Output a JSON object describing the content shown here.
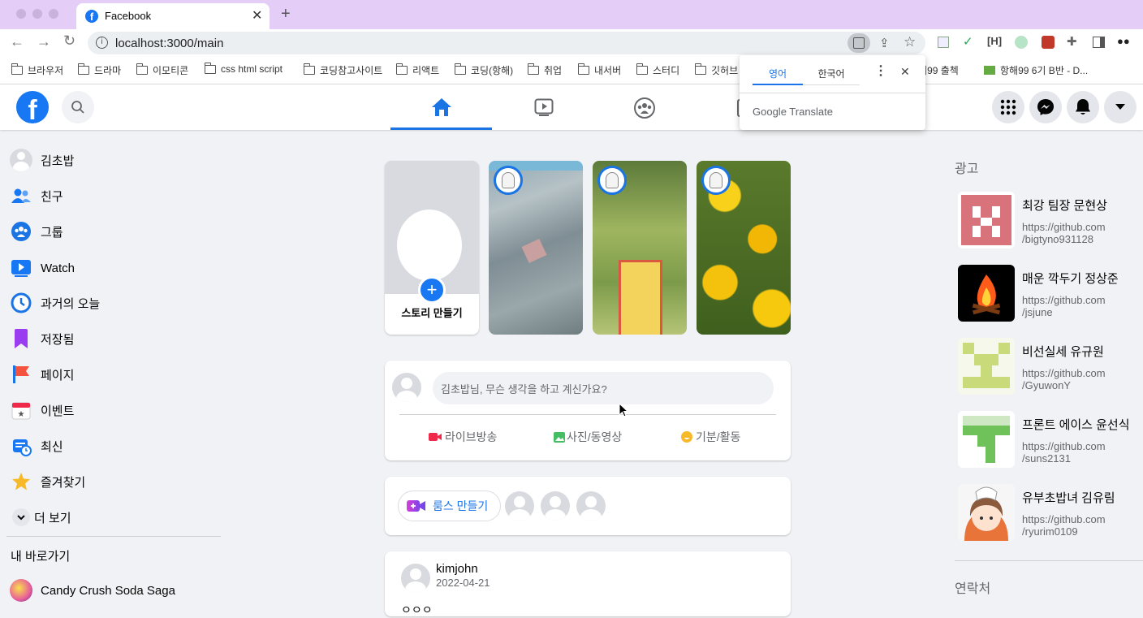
{
  "browser": {
    "tab_title": "Facebook",
    "url": "localhost:3000/main",
    "bookmarks": [
      "브라우저",
      "드라마",
      "이모티콘",
      "css html script",
      "코딩참고사이트",
      "리액트",
      "코딩(항해)",
      "취업",
      "내서버",
      "스터디",
      "깃허브"
    ],
    "bookmark_extra": [
      "항해99 출첵",
      "항해99 6기 B반 - D..."
    ]
  },
  "translate_popup": {
    "tab_source": "영어",
    "tab_target": "한국어",
    "brand": "Google Translate"
  },
  "sidebar": {
    "items": [
      {
        "label": "김초밥",
        "icon": "avatar-icon"
      },
      {
        "label": "친구",
        "icon": "friends-icon"
      },
      {
        "label": "그룹",
        "icon": "groups-icon"
      },
      {
        "label": "Watch",
        "icon": "watch-icon"
      },
      {
        "label": "과거의 오늘",
        "icon": "memories-icon"
      },
      {
        "label": "저장됨",
        "icon": "saved-icon"
      },
      {
        "label": "페이지",
        "icon": "pages-icon"
      },
      {
        "label": "이벤트",
        "icon": "events-icon"
      },
      {
        "label": "최신",
        "icon": "recent-icon"
      },
      {
        "label": "즐겨찾기",
        "icon": "favorites-icon"
      }
    ],
    "more": "더 보기",
    "shortcuts_title": "내 바로가기",
    "shortcut": "Candy Crush Soda Saga"
  },
  "stories": {
    "create_label": "스토리 만들기"
  },
  "composer": {
    "placeholder": "김초밥님, 무슨 생각을 하고 계신가요?",
    "live": "라이브방송",
    "photo": "사진/동영상",
    "feeling": "기분/활동"
  },
  "rooms": {
    "create_label": "룸스 만들기"
  },
  "post": {
    "author": "kimjohn",
    "date": "2022-04-21",
    "text_preview": "ㅇㅇㅇ"
  },
  "right": {
    "ads_title": "광고",
    "ads": [
      {
        "title": "최강 팀장 문현상",
        "url1": "https://github.com",
        "url2": "/bigtyno931128"
      },
      {
        "title": "매운 깍두기 정상준",
        "url1": "https://github.com",
        "url2": "/jsjune"
      },
      {
        "title": "비선실세 유규원",
        "url1": "https://github.com",
        "url2": "/GyuwonY"
      },
      {
        "title": "프론트 에이스 윤선식",
        "url1": "https://github.com",
        "url2": "/suns2131"
      },
      {
        "title": "유부초밥녀 김유림",
        "url1": "https://github.com",
        "url2": "/ryurim0109"
      }
    ],
    "contacts_title": "연락처"
  },
  "colors": {
    "brand": "#1877f2",
    "nav_active": "#1b74e4"
  }
}
